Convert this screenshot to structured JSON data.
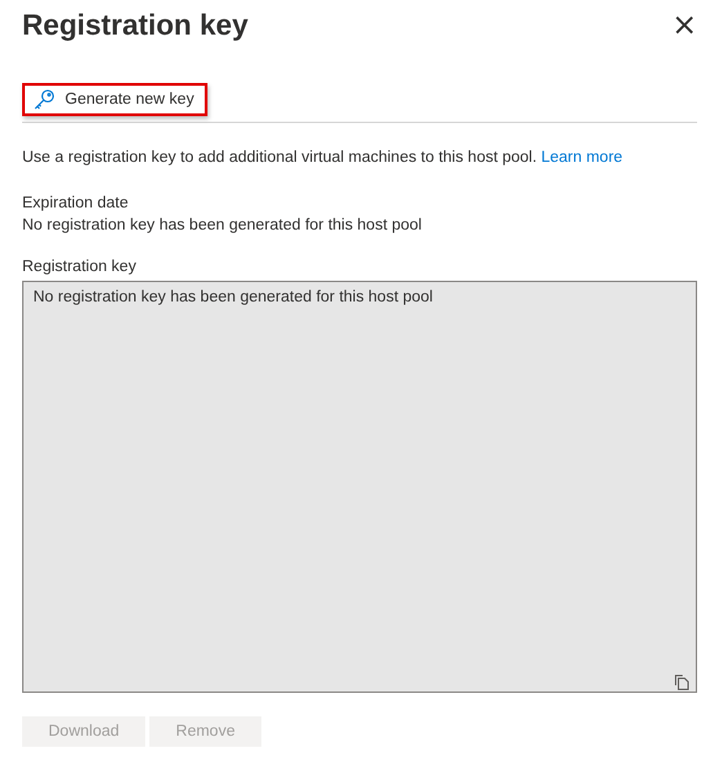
{
  "panel": {
    "title": "Registration key",
    "close": "×"
  },
  "toolbar": [
    {
      "label": "Generate new key",
      "highlighted": true
    }
  ],
  "description": {
    "text": "Use a registration key to add additional virtual machines to this host pool.",
    "link": "Learn more"
  },
  "expiration": {
    "label": "Expiration date",
    "value": "No registration key has been generated for this host pool"
  },
  "registration_key": {
    "label": "Registration key",
    "value": "No registration key has been generated for this host pool",
    "disabled": true
  },
  "buttons": [
    {
      "label": "Download",
      "disabled": true
    },
    {
      "label": "Remove",
      "disabled": true
    }
  ]
}
